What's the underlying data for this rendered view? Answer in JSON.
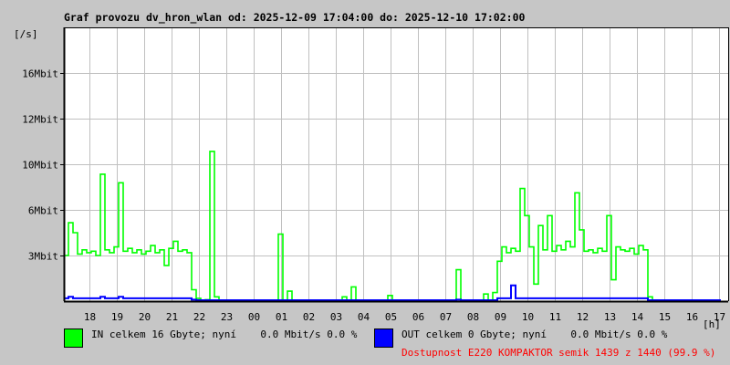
{
  "title": "Graf provozu dv_hron_wlan od: 2025-12-09 17:04:00 do: 2025-12-10 17:02:00",
  "legend": {
    "in": {
      "label": "IN celkem 16 Gbyte; nyní    0.0 Mbit/s 0.0 %",
      "color": "#00ff00"
    },
    "out": {
      "label": "OUT celkem 0 Gbyte; nyní    0.0 Mbit/s 0.0 %",
      "color": "#0000ff"
    },
    "availability": "Dostupnost E220 KOMPAKTOR semik 1439 z 1440 (99.9 %)",
    "availability_color": "#ff0000"
  },
  "chart_data": {
    "type": "line",
    "title": "Graf provozu dv_hron_wlan od: 2025-12-09 17:04:00 do: 2025-12-10 17:02:00",
    "ylabel": "[/s]",
    "xlabel": "[h]",
    "ylim": [
      0,
      19.2
    ],
    "grid": true,
    "y_ticks": [
      {
        "value": 3.2,
        "label": "3Mbit"
      },
      {
        "value": 6.4,
        "label": "6Mbit"
      },
      {
        "value": 9.6,
        "label": "10Mbit"
      },
      {
        "value": 12.8,
        "label": "12Mbit"
      },
      {
        "value": 16,
        "label": "16Mbit"
      }
    ],
    "x_unit": "minutes since 17:04",
    "x_range": [
      0,
      1440
    ],
    "sample_interval_min": 10,
    "x_ticks": [
      {
        "value": 56,
        "label": "18"
      },
      {
        "value": 116,
        "label": "19"
      },
      {
        "value": 176,
        "label": "20"
      },
      {
        "value": 236,
        "label": "21"
      },
      {
        "value": 296,
        "label": "22"
      },
      {
        "value": 356,
        "label": "23"
      },
      {
        "value": 416,
        "label": "00"
      },
      {
        "value": 476,
        "label": "01"
      },
      {
        "value": 536,
        "label": "02"
      },
      {
        "value": 596,
        "label": "03"
      },
      {
        "value": 656,
        "label": "04"
      },
      {
        "value": 716,
        "label": "05"
      },
      {
        "value": 776,
        "label": "06"
      },
      {
        "value": 836,
        "label": "07"
      },
      {
        "value": 896,
        "label": "08"
      },
      {
        "value": 956,
        "label": "09"
      },
      {
        "value": 1016,
        "label": "10"
      },
      {
        "value": 1076,
        "label": "11"
      },
      {
        "value": 1136,
        "label": "12"
      },
      {
        "value": 1196,
        "label": "13"
      },
      {
        "value": 1256,
        "label": "14"
      },
      {
        "value": 1316,
        "label": "15"
      },
      {
        "value": 1376,
        "label": "16"
      },
      {
        "value": 1436,
        "label": "17"
      }
    ],
    "series": [
      {
        "name": "IN",
        "unit": "Mbit/s",
        "color": "#00ff00",
        "values": [
          3.2,
          5.5,
          4.8,
          3.3,
          3.6,
          3.4,
          3.5,
          3.2,
          8.9,
          3.6,
          3.4,
          3.8,
          8.3,
          3.5,
          3.7,
          3.4,
          3.6,
          3.3,
          3.5,
          3.9,
          3.4,
          3.6,
          2.5,
          3.7,
          4.2,
          3.5,
          3.6,
          3.4,
          0.8,
          0.2,
          0,
          0.1,
          10.5,
          0.3,
          0,
          0,
          0,
          0,
          0,
          0,
          0,
          0,
          0,
          0,
          0,
          0,
          0,
          4.7,
          0,
          0.7,
          0,
          0,
          0,
          0,
          0,
          0,
          0,
          0,
          0,
          0,
          0,
          0.3,
          0,
          1.0,
          0,
          0,
          0,
          0,
          0,
          0,
          0,
          0.4,
          0,
          0,
          0,
          0,
          0,
          0,
          0,
          0,
          0,
          0,
          0,
          0,
          0,
          0,
          2.2,
          0,
          0,
          0,
          0,
          0,
          0.5,
          0,
          0.6,
          2.8,
          3.8,
          3.4,
          3.7,
          3.5,
          7.9,
          6.0,
          3.8,
          1.2,
          5.3,
          3.6,
          6.0,
          3.5,
          3.9,
          3.6,
          4.2,
          3.8,
          7.6,
          5.0,
          3.5,
          3.6,
          3.4,
          3.7,
          3.5,
          6.0,
          1.5,
          3.8,
          3.6,
          3.5,
          3.7,
          3.3,
          3.9,
          3.6,
          0.3,
          0,
          0,
          0,
          0,
          0,
          0,
          0,
          0,
          0,
          0,
          0,
          0,
          0,
          0,
          0
        ]
      },
      {
        "name": "OUT",
        "unit": "Mbit/s",
        "color": "#0000ff",
        "values": [
          0.2,
          0.3,
          0.2,
          0.2,
          0.2,
          0.2,
          0.2,
          0.2,
          0.3,
          0.2,
          0.2,
          0.2,
          0.3,
          0.2,
          0.2,
          0.2,
          0.2,
          0.2,
          0.2,
          0.2,
          0.2,
          0.2,
          0.2,
          0.2,
          0.2,
          0.2,
          0.2,
          0.2,
          0.1,
          0,
          0,
          0,
          0,
          0,
          0,
          0,
          0,
          0,
          0,
          0,
          0,
          0,
          0,
          0,
          0,
          0,
          0,
          0,
          0,
          0,
          0,
          0,
          0,
          0,
          0,
          0,
          0,
          0,
          0,
          0,
          0,
          0,
          0,
          0,
          0,
          0,
          0,
          0,
          0,
          0,
          0,
          0,
          0,
          0,
          0,
          0,
          0,
          0,
          0,
          0,
          0,
          0,
          0,
          0,
          0,
          0,
          0.1,
          0,
          0,
          0,
          0,
          0,
          0,
          0,
          0,
          0.2,
          0.2,
          0.2,
          1.1,
          0.2,
          0.2,
          0.2,
          0.2,
          0.2,
          0.2,
          0.2,
          0.2,
          0.2,
          0.2,
          0.2,
          0.2,
          0.2,
          0.2,
          0.2,
          0.2,
          0.2,
          0.2,
          0.2,
          0.2,
          0.2,
          0.2,
          0.2,
          0.2,
          0.2,
          0.2,
          0.2,
          0.2,
          0.2,
          0,
          0,
          0,
          0,
          0,
          0,
          0,
          0,
          0,
          0,
          0,
          0,
          0,
          0,
          0,
          0
        ]
      }
    ]
  }
}
